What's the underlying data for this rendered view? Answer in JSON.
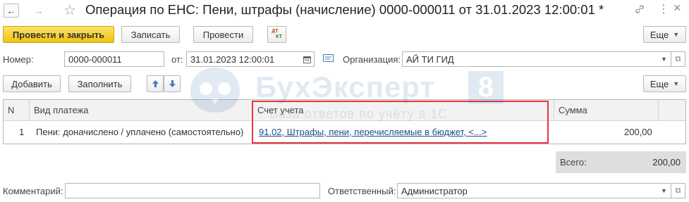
{
  "window": {
    "title": "Операция по ЕНС: Пени, штрафы (начисление) 0000-000011 от 31.01.2023 12:00:01 *",
    "back_icon": "←",
    "forward_icon": "→",
    "star_icon": "☆",
    "link_icon": "🔗",
    "menu_icon": "⋮",
    "close_icon": "×"
  },
  "toolbar": {
    "post_close_label": "Провести и закрыть",
    "save_label": "Записать",
    "post_label": "Провести",
    "dtkt_top": "ДТ",
    "dtkt_bottom": "КТ",
    "more_label": "Еще"
  },
  "form": {
    "number_label": "Номер:",
    "number_value": "0000-000011",
    "date_label": "от:",
    "date_value": "31.01.2023 12:00:01",
    "org_label": "Организация:",
    "org_value": "АЙ ТИ ГИД"
  },
  "table_toolbar": {
    "add_label": "Добавить",
    "fill_label": "Заполнить",
    "more_label": "Еще"
  },
  "table": {
    "columns": [
      "N",
      "Вид платежа",
      "Счет учета",
      "Сумма"
    ],
    "rows": [
      {
        "n": "1",
        "kind": "Пени: доначислено / уплачено (самостоятельно)",
        "account": "91.02, Штрафы, пени, перечисляемые в бюджет, <...>",
        "amount": "200,00"
      }
    ]
  },
  "totals": {
    "label": "Всего:",
    "value": "200,00"
  },
  "footer": {
    "comment_label": "Комментарий:",
    "comment_value": "",
    "responsible_label": "Ответственный:",
    "responsible_value": "Администратор"
  },
  "watermark": {
    "brand": "БухЭксперт",
    "brand_num": "8",
    "tagline": "База ответов по учёту в 1С"
  },
  "colors": {
    "primary_button": "#f1c40f",
    "highlight_border": "#e8363f",
    "link": "#1a4f8a",
    "watermark": "#1f5fa8"
  }
}
